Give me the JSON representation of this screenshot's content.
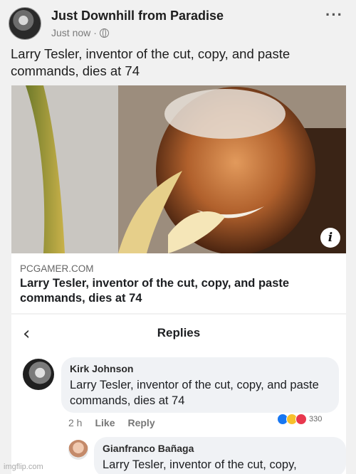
{
  "post": {
    "page_name": "Just Downhill from Paradise",
    "time": "Just now",
    "separator": "·",
    "text": "Larry Tesler, inventor of the cut, copy, and paste commands, dies at 74"
  },
  "link_card": {
    "source": "PCGAMER.COM",
    "title": "Larry Tesler, inventor of the cut, copy, and paste commands, dies at 74",
    "info_glyph": "i"
  },
  "replies": {
    "back_glyph": "‹",
    "title": "Replies",
    "comments": [
      {
        "author": "Kirk Johnson",
        "text": "Larry Tesler, inventor of the cut, copy, and paste commands, dies at 74",
        "time": "2 h",
        "like_label": "Like",
        "reply_label": "Reply",
        "reaction_count": "330",
        "reactions": [
          "like",
          "haha",
          "love"
        ]
      },
      {
        "author": "Gianfranco Bañaga",
        "text": "Larry Tesler, inventor of the cut, copy,"
      }
    ]
  },
  "watermark": "imgflip.com",
  "colors": {
    "like": "#1877f2",
    "haha": "#f7c02b",
    "love": "#e8384e",
    "background": "#f1f1f1"
  }
}
